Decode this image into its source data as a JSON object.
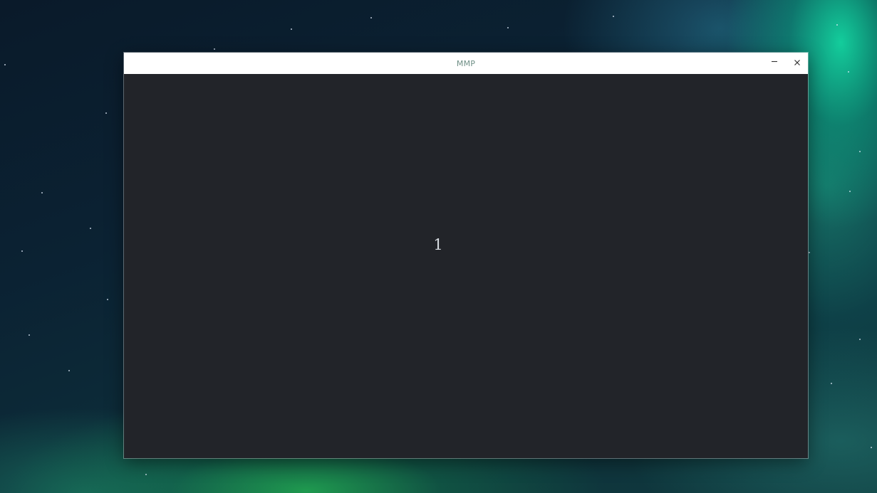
{
  "window": {
    "title": "MMP",
    "minimize_icon": "minimize-icon",
    "close_icon": "close-icon"
  },
  "content": {
    "value": "1"
  },
  "colors": {
    "content_background": "#222429",
    "titlebar_background": "#ffffff",
    "title_text": "#6f8f86"
  }
}
